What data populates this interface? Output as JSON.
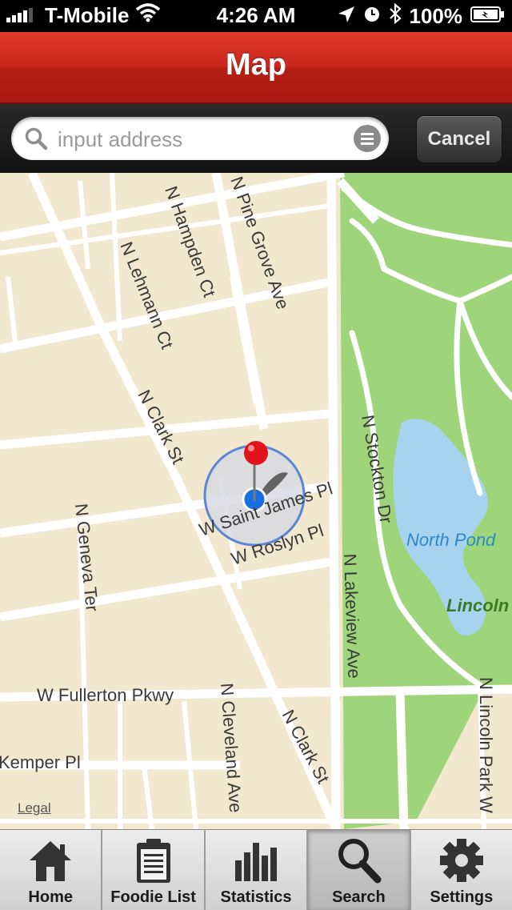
{
  "status_bar": {
    "carrier": "T-Mobile",
    "time": "4:26 AM",
    "battery": "100%",
    "icons": [
      "signal-icon",
      "wifi-icon",
      "location-icon",
      "alarm-icon",
      "bluetooth-icon",
      "battery-icon"
    ]
  },
  "navbar": {
    "title": "Map",
    "color": "#c8261c"
  },
  "search": {
    "placeholder": "input address",
    "value": "",
    "cancel_label": "Cancel"
  },
  "map": {
    "labels": {
      "pine_grove": "N Pine Grove Ave",
      "hampden": "N Hampden Ct",
      "lehmann": "N Lehmann Ct",
      "clark_north": "N Clark St",
      "clark_south": "N Clark St",
      "stockton": "N Stockton Dr",
      "north_pond": "North Pond",
      "lincoln": "Lincoln",
      "saint_james": "W Saint James Pl",
      "roslyn": "W Roslyn Pl",
      "geneva": "N Geneva Ter",
      "lakeview": "N Lakeview Ave",
      "fullerton": "W Fullerton Pkwy",
      "cleveland": "N Cleveland Ave",
      "kemper": "Kemper Pl",
      "lincoln_park_west": "N Lincoln Park W"
    },
    "legal": "Legal",
    "colors": {
      "land": "#f1e8cf",
      "park": "#9fd57a",
      "water": "#a7d3ef",
      "road": "#ffffff",
      "pin": "#e0141a",
      "location": "#1a6fe0"
    }
  },
  "tabs": [
    {
      "label": "Home",
      "icon": "home-icon",
      "active": false
    },
    {
      "label": "Foodie List",
      "icon": "clipboard-icon",
      "active": false
    },
    {
      "label": "Statistics",
      "icon": "bar-chart-icon",
      "active": false
    },
    {
      "label": "Search",
      "icon": "search-icon",
      "active": true
    },
    {
      "label": "Settings",
      "icon": "gear-icon",
      "active": false
    }
  ]
}
